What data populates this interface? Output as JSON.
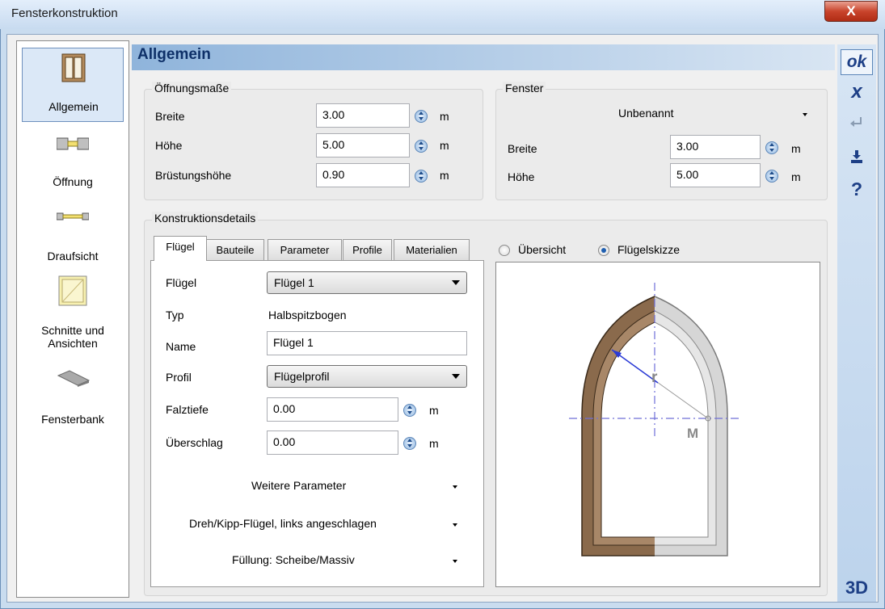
{
  "window": {
    "title": "Fensterkonstruktion",
    "close_glyph": "X"
  },
  "sidebar": {
    "items": [
      {
        "label": "Allgemein",
        "icon": "window-icon",
        "selected": true
      },
      {
        "label": "Öffnung",
        "icon": "opening-icon"
      },
      {
        "label": "Draufsicht",
        "icon": "top-view-icon"
      },
      {
        "label": "Schnitte und Ansichten",
        "icon": "sections-icon"
      },
      {
        "label": "Fensterbank",
        "icon": "window-sill-icon"
      }
    ]
  },
  "header": {
    "title": "Allgemein"
  },
  "toolbar_right": {
    "ok": "ok",
    "cancel": "x",
    "apply_icon": "enter-arrow-icon",
    "save_icon": "save-icon",
    "help": "?",
    "view3d": "3D"
  },
  "oeffnungsmasse": {
    "title": "Öffnungsmaße",
    "rows": [
      {
        "label": "Breite",
        "value": "3.00",
        "unit": "m"
      },
      {
        "label": "Höhe",
        "value": "5.00",
        "unit": "m"
      },
      {
        "label": "Brüstungshöhe",
        "value": "0.90",
        "unit": "m"
      }
    ]
  },
  "fenster": {
    "title": "Fenster",
    "preset": "Unbenannt",
    "rows": [
      {
        "label": "Breite",
        "value": "3.00",
        "unit": "m"
      },
      {
        "label": "Höhe",
        "value": "5.00",
        "unit": "m"
      }
    ]
  },
  "konstruktion": {
    "title": "Konstruktionsdetails",
    "tabs": [
      "Flügel",
      "Bauteile",
      "Parameter",
      "Profile",
      "Materialien"
    ],
    "active_tab": "Flügel",
    "fluegel_label": "Flügel",
    "fluegel_value": "Flügel 1",
    "typ_label": "Typ",
    "typ_value": "Halbspitzbogen",
    "name_label": "Name",
    "name_value": "Flügel 1",
    "profil_label": "Profil",
    "profil_value": "Flügelprofil",
    "falztiefe_label": "Falztiefe",
    "falztiefe_value": "0.00",
    "ueberschlag_label": "Überschlag",
    "ueberschlag_value": "0.00",
    "unit": "m",
    "expanders": [
      "Weitere Parameter",
      "Dreh/Kipp-Flügel, links angeschlagen",
      "Füllung: Scheibe/Massiv"
    ]
  },
  "preview": {
    "radio_overview": "Übersicht",
    "radio_sketch": "Flügelskizze",
    "selected": "Flügelskizze",
    "label_r": "r",
    "label_m": "M"
  }
}
